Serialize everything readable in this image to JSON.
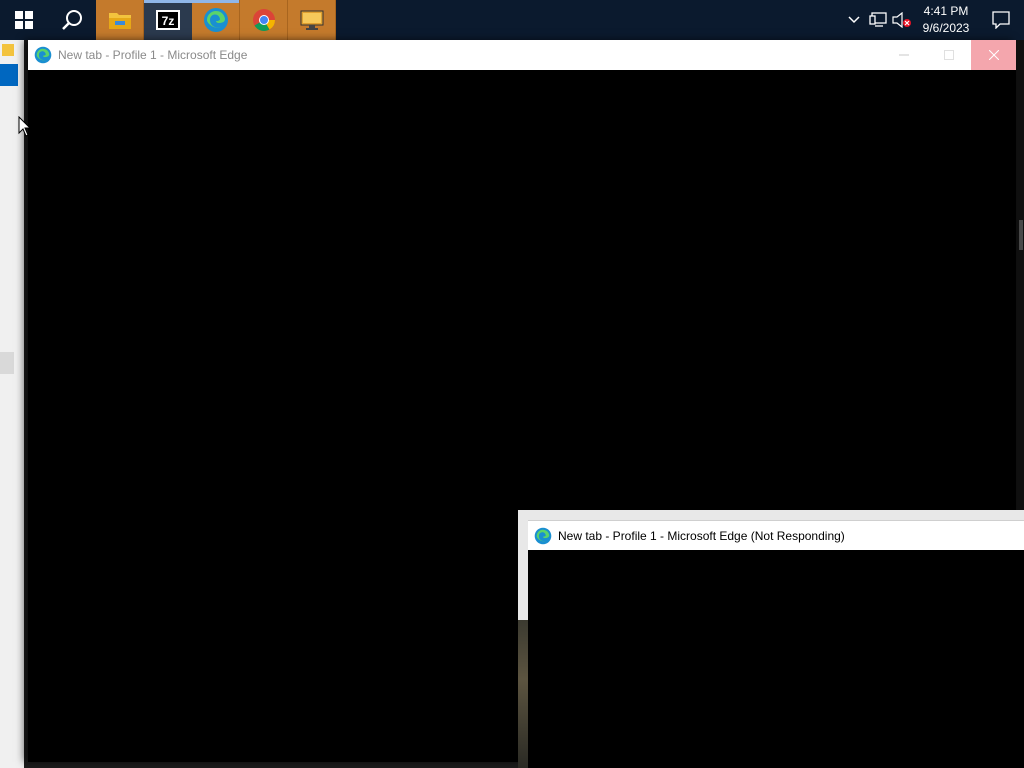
{
  "taskbar": {
    "apps": [
      {
        "name": "Start",
        "icon": "windows-logo-icon"
      },
      {
        "name": "Search",
        "icon": "search-icon"
      },
      {
        "name": "File Explorer",
        "icon": "folder-icon"
      },
      {
        "name": "7-Zip",
        "icon": "7zip-icon",
        "label": "7z"
      },
      {
        "name": "Microsoft Edge",
        "icon": "edge-icon"
      },
      {
        "name": "Google Chrome",
        "icon": "chrome-icon"
      },
      {
        "name": "Display",
        "icon": "monitor-icon"
      }
    ],
    "clock": {
      "time": "4:41 PM",
      "date": "9/6/2023"
    },
    "tray_icons": [
      "chevron-up-icon",
      "network-icon",
      "volume-muted-icon"
    ],
    "notification_icon": "action-center-icon"
  },
  "window_main": {
    "title": "New tab - Profile 1 - Microsoft Edge"
  },
  "window_not_responding": {
    "title": "New tab - Profile 1 - Microsoft Edge (Not Responding)"
  },
  "colors": {
    "taskbar_bg": "#0b1a2e",
    "pinned_bg": "#c47a2c",
    "close_hover": "#f4a6ad",
    "window_content": "#000000"
  }
}
